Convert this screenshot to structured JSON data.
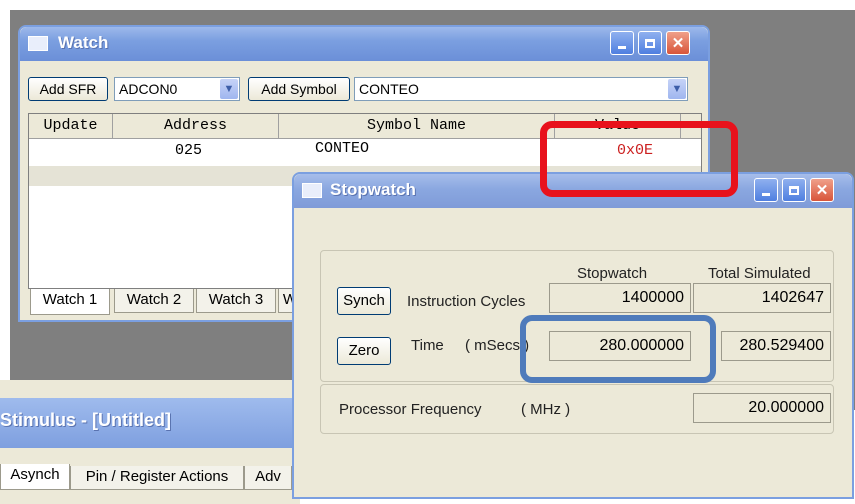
{
  "watch_window": {
    "title": "Watch",
    "add_sfr_label": "Add SFR",
    "sfr_selected": "ADCON0",
    "add_symbol_label": "Add Symbol",
    "symbol_selected": "CONTEO",
    "columns": [
      "Update",
      "Address",
      "Symbol Name",
      "Value"
    ],
    "rows": [
      {
        "update": "",
        "address": "025",
        "symbol": "CONTEO",
        "value": "0x0E"
      }
    ],
    "tabs": [
      "Watch 1",
      "Watch 2",
      "Watch 3",
      "W"
    ]
  },
  "stopwatch_window": {
    "title": "Stopwatch",
    "col_stopwatch": "Stopwatch",
    "col_total": "Total Simulated",
    "synch_label": "Synch",
    "instruction_cycles_label": "Instruction  Cycles",
    "instruction_cycles_stopwatch": "1400000",
    "instruction_cycles_total": "1402647",
    "zero_label": "Zero",
    "time_label": "Time",
    "time_unit": "( mSecs )",
    "time_stopwatch": "280.000000",
    "time_total": "280.529400",
    "proc_freq_label": "Processor Frequency",
    "proc_freq_unit": "( MHz )",
    "proc_freq_value": "20.000000"
  },
  "stimulus_window": {
    "title": "Stimulus - [Untitled]",
    "tabs": [
      "Asynch",
      "Pin / Register Actions",
      "Adv"
    ]
  },
  "colors": {
    "titlebar_blue": "#7b9fe0",
    "annotation_red": "#e8121c",
    "annotation_blue": "#4f7bbb",
    "value_red": "#cc2020"
  }
}
